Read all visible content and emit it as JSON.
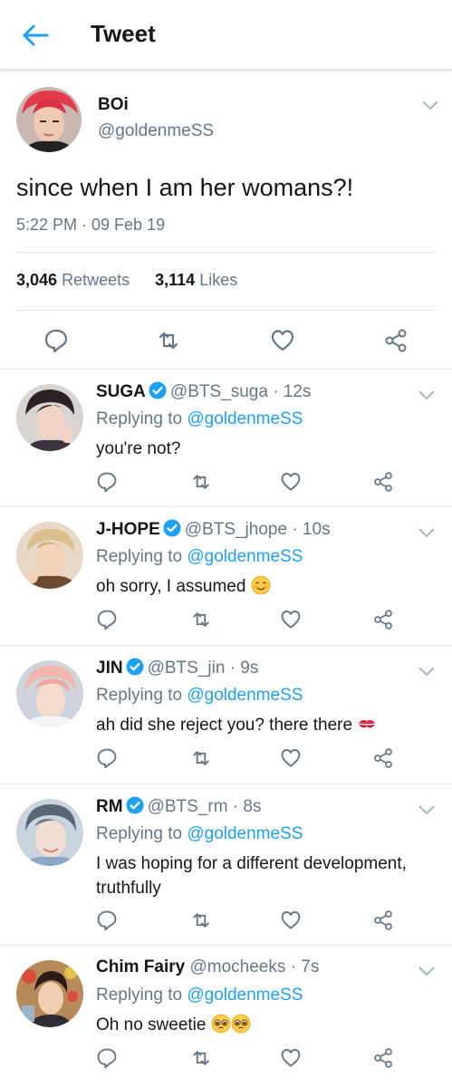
{
  "header": {
    "title": "Tweet",
    "back_icon": "arrow-left-icon"
  },
  "main_tweet": {
    "display_name": "BOi",
    "handle": "@goldenmeSS",
    "text": "since when I am her womans?!",
    "timestamp": "5:22 PM · 09 Feb 19",
    "retweets_count": "3,046",
    "retweets_label": "Retweets",
    "likes_count": "3,114",
    "likes_label": "Likes"
  },
  "replies": [
    {
      "name": "SUGA",
      "verified": true,
      "meta": "@BTS_suga · 12s",
      "replying_prefix": "Replying to ",
      "mention": "@goldenmeSS",
      "text": "you're not?",
      "emoji": []
    },
    {
      "name": "J-HOPE",
      "verified": true,
      "meta": "@BTS_jhope · 10s",
      "replying_prefix": "Replying to ",
      "mention": "@goldenmeSS",
      "text": "oh sorry, I assumed",
      "emoji": [
        "smiling-face-icon"
      ]
    },
    {
      "name": "JIN",
      "verified": true,
      "meta": "@BTS_jin · 9s",
      "replying_prefix": "Replying to ",
      "mention": "@goldenmeSS",
      "text": "ah did she reject you? there there",
      "emoji": [
        "kiss-mark-icon"
      ]
    },
    {
      "name": "RM",
      "verified": true,
      "meta": "@BTS_rm · 8s",
      "replying_prefix": "Replying to ",
      "mention": "@goldenmeSS",
      "text": "I was hoping for a different development, truthfully",
      "emoji": []
    },
    {
      "name": "Chim Fairy",
      "verified": false,
      "meta": "@mocheeks · 7s",
      "replying_prefix": "Replying to ",
      "mention": "@goldenmeSS",
      "text": "Oh no sweetie",
      "emoji": [
        "pleading-face-icon",
        "pleading-face-icon"
      ]
    }
  ],
  "colors": {
    "accent": "#1da1f2",
    "secondary_text": "#657786",
    "action_icon": "#657786",
    "divider": "#e1e8ed"
  },
  "icons": {
    "reply": "reply-icon",
    "retweet": "retweet-icon",
    "like": "heart-icon",
    "share": "share-icon",
    "menu": "chevron-down-icon",
    "verified": "verified-badge-icon"
  }
}
